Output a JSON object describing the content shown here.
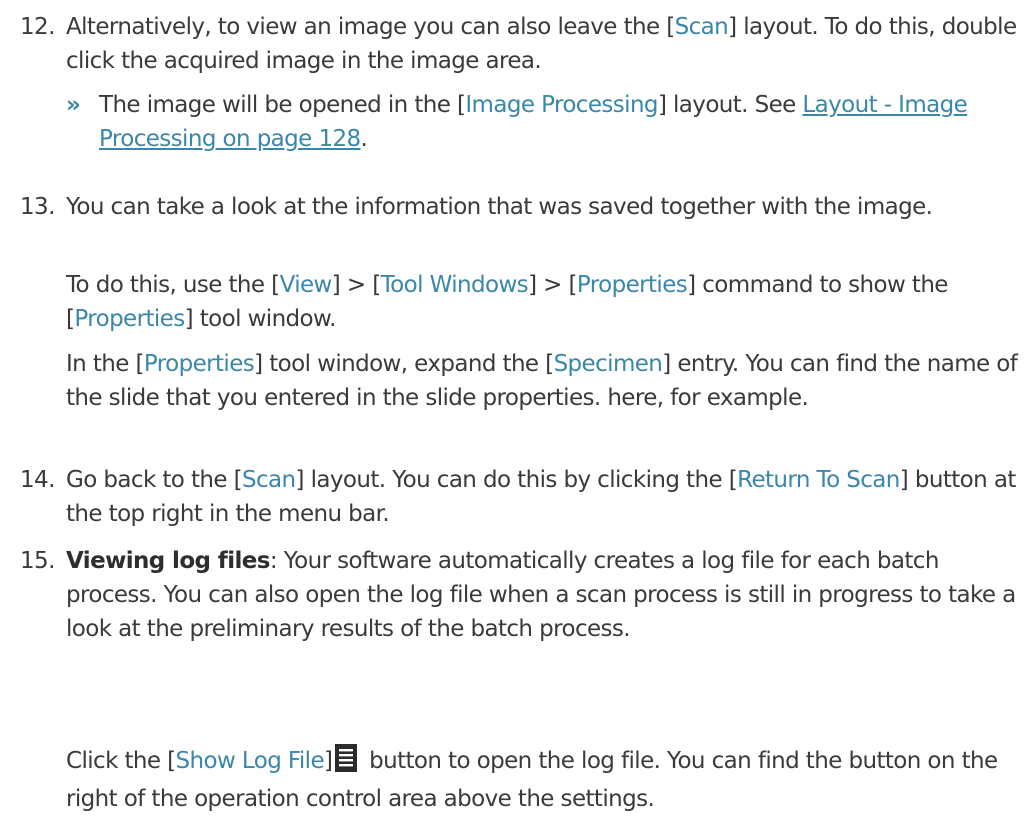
{
  "steps": [
    {
      "num": "12.",
      "intro": "Alternatively, to view an image you can also leave the [",
      "kw1": "Scan",
      "text1": "] layout. To do this, double click the acquired image in the image area.",
      "result": {
        "symbol": "»",
        "intro": "The image will be opened in the [",
        "kw1": "Image Processing",
        "text1": "] layout. See ",
        "link": "Layout - Image Processing on page 128",
        "end": "."
      }
    },
    {
      "num": "13.",
      "text": "You can take a look at the information that was saved together with the image.",
      "para1": {
        "t1": "To do this, use the [",
        "k1": "View",
        "t2": "] > [",
        "k2": "Tool Windows",
        "t3": "] > [",
        "k3": "Properties",
        "t4": "] command to show the [",
        "k4": "Properties",
        "t5": "] tool window."
      },
      "para2": {
        "t1": "In the [",
        "k1": "Properties",
        "t2": "] tool window, expand the [",
        "k2": "Specimen",
        "t3": "] entry. You can find the name of the slide that you entered in the slide properties. here, for example."
      }
    },
    {
      "num": "14.",
      "t1": "Go back to the [",
      "k1": "Scan",
      "t2": "] layout. You can do this by clicking the [",
      "k2": "Return To Scan",
      "t3": "] button at the top right in the menu bar."
    },
    {
      "num": "15.",
      "bold": "Viewing log files",
      "text": ": Your software automatically creates a log file for each batch process. You can also open the log file when a scan process is still in progress to take a look at the preliminary results of the batch process.",
      "para1": {
        "t1": "Click the [",
        "k1": "Show Log File",
        "t2": "]",
        "icon": "log-file-icon",
        "t3": " button to open the log file. You can find the button on the right of the operation control area above the settings."
      }
    }
  ],
  "colors": {
    "text": "#3a3a3a",
    "keyword": "#3a87a9"
  }
}
